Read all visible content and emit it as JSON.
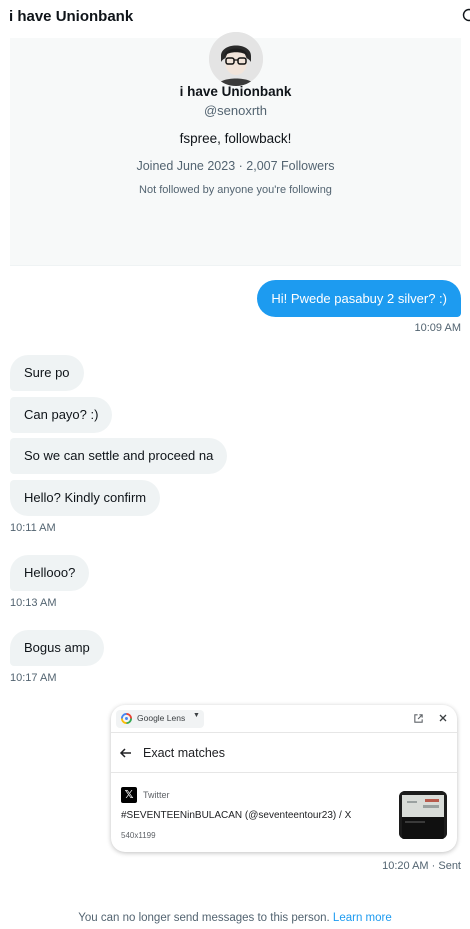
{
  "header": {
    "title": "i have Unionbank",
    "info_icon": "info-icon"
  },
  "profile": {
    "name": "i have Unionbank",
    "handle": "@senoxrth",
    "bio": "fspree, followback!",
    "joined": "Joined June 2023 · 2,007 Followers",
    "followed_by": "Not followed by anyone you're following",
    "avatar_icon": "user-avatar"
  },
  "messages": [
    {
      "direction": "outgoing",
      "text": "Hi! Pwede pasabuy 2 silver? :)"
    },
    {
      "direction": "meta",
      "text": "10:09 AM"
    },
    {
      "direction": "incoming",
      "text": "Sure po"
    },
    {
      "direction": "incoming",
      "text": "Can payo? :)"
    },
    {
      "direction": "incoming",
      "text": "So we can settle and proceed na"
    },
    {
      "direction": "incoming",
      "text": "Hello? Kindly confirm"
    },
    {
      "direction": "meta",
      "text": "10:11 AM"
    },
    {
      "direction": "incoming",
      "text": "Hellooo?"
    },
    {
      "direction": "meta",
      "text": "10:13 AM"
    },
    {
      "direction": "incoming",
      "text": "Bogus amp"
    },
    {
      "direction": "meta",
      "text": "10:17 AM"
    }
  ],
  "lens_card": {
    "app_label": "Google Lens",
    "heading": "Exact matches",
    "source": "Twitter",
    "result_title": "#SEVENTEENinBULACAN (@seventeentour23) / X",
    "dimensions": "540x1199",
    "icons": [
      "google-lens-icon",
      "open-external-icon",
      "close-icon",
      "back-arrow-icon",
      "x-logo-icon"
    ]
  },
  "image_time": "10:20 AM · Sent",
  "footer": {
    "notice": "You can no longer send messages to this person.",
    "link_label": "Learn more"
  },
  "colors": {
    "accent": "#1d9bf0",
    "incoming_bubble": "#eff3f4",
    "profile_bg": "#f7f9f9",
    "muted_text": "#536471"
  }
}
